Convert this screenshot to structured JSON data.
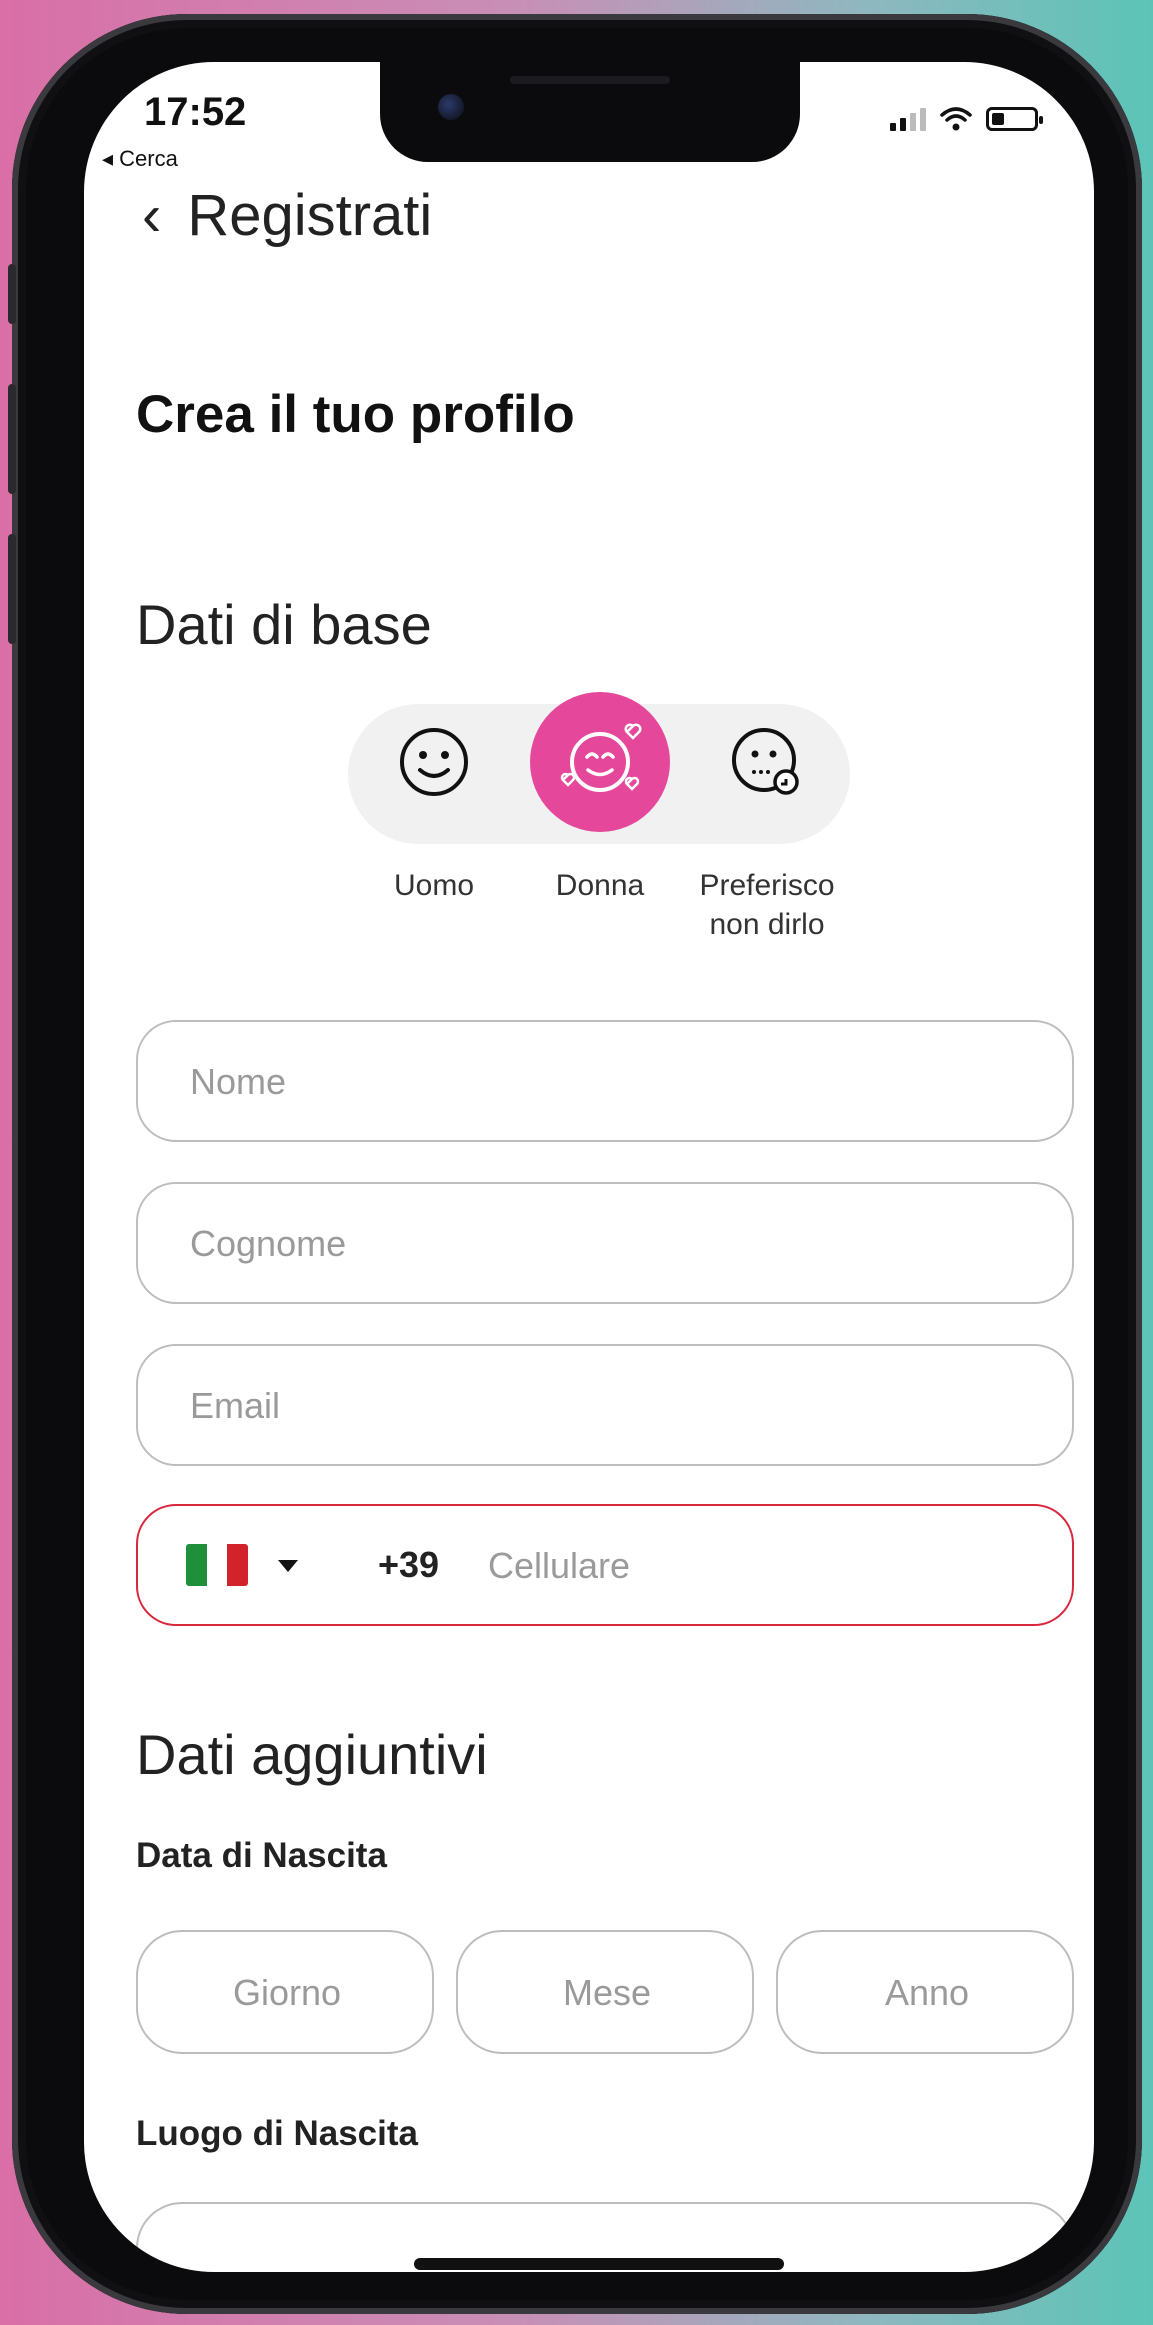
{
  "status_bar": {
    "time": "17:52",
    "back_app": "◂ Cerca",
    "battery_level": 0.3
  },
  "nav": {
    "back_glyph": "‹",
    "title": "Registrati"
  },
  "profile_heading": "Crea il tuo profilo",
  "basic": {
    "title": "Dati di base",
    "gender_options": [
      {
        "label": "Uomo",
        "icon": "smiley-face-icon",
        "selected": false
      },
      {
        "label": "Donna",
        "icon": "hearts-face-icon",
        "selected": true
      },
      {
        "label": "Preferisco\nnon dirlo",
        "icon": "face-with-lock-icon",
        "selected": false
      }
    ],
    "first_name_placeholder": "Nome",
    "last_name_placeholder": "Cognome",
    "email_placeholder": "Email",
    "phone": {
      "country_flag": "italy-flag-icon",
      "prefix": "+39",
      "placeholder": "Cellulare"
    }
  },
  "additional": {
    "title": "Dati aggiuntivi",
    "birth_date_label": "Data di Nascita",
    "day_placeholder": "Giorno",
    "month_placeholder": "Mese",
    "year_placeholder": "Anno",
    "birth_place_label": "Luogo di Nascita"
  },
  "colors": {
    "accent": "#e5489a",
    "error_border": "#d9273b",
    "field_border": "#bdbdbd"
  }
}
